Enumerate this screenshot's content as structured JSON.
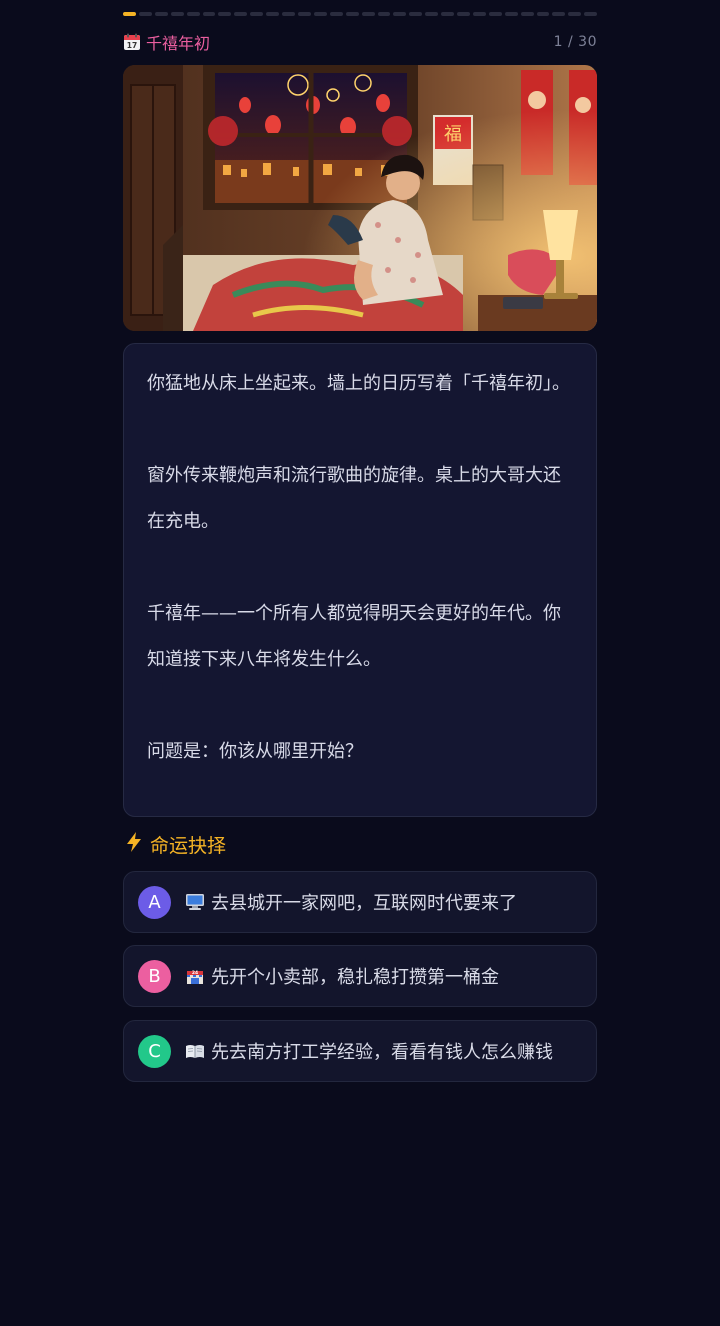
{
  "progress": {
    "current": 1,
    "total": 30,
    "counter_text": "1 / 30",
    "active_color": "#f5b325",
    "inactive_color": "#2a2c3e"
  },
  "header": {
    "icon": "calendar-icon",
    "chapter_title": "千禧年初",
    "title_color": "#ec5fa0"
  },
  "scene": {
    "image": "bedroom-new-year-illustration"
  },
  "story": {
    "paragraphs": [
      "你猛地从床上坐起来。墙上的日历写着「千禧年初」。",
      "窗外传来鞭炮声和流行歌曲的旋律。桌上的大哥大还在充电。",
      "千禧年——一个所有人都觉得明天会更好的年代。你知道接下来八年将发生什么。",
      "问题是：你该从哪里开始？"
    ]
  },
  "choices_section": {
    "icon": "lightning-icon",
    "title": "命运抉择",
    "title_color": "#f5b325"
  },
  "choices": [
    {
      "letter": "A",
      "badge_color": "#6c5ce7",
      "icon": "computer-icon",
      "text": "去县城开一家网吧，互联网时代要来了"
    },
    {
      "letter": "B",
      "badge_color": "#ec5fa0",
      "icon": "shop-icon",
      "text": "先开个小卖部，稳扎稳打攒第一桶金"
    },
    {
      "letter": "C",
      "badge_color": "#22c88a",
      "icon": "book-icon",
      "text": "先去南方打工学经验，看看有钱人怎么赚钱"
    }
  ]
}
